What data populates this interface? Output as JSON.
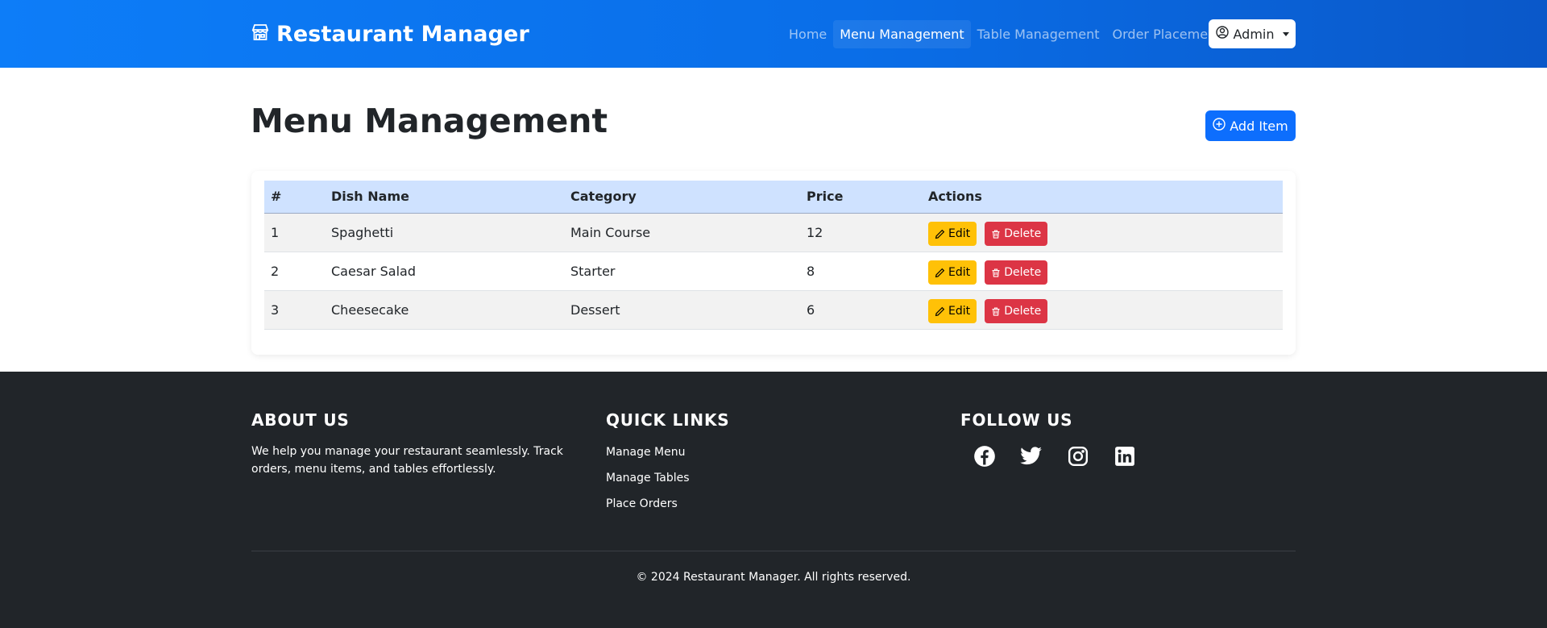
{
  "navbar": {
    "brand": "Restaurant Manager",
    "links": [
      {
        "label": "Home"
      },
      {
        "label": "Menu Management"
      },
      {
        "label": "Table Management"
      },
      {
        "label": "Order Placement"
      }
    ],
    "user_menu": "Admin"
  },
  "page": {
    "title": "Menu Management",
    "add_button": "Add Item"
  },
  "table": {
    "headers": [
      "#",
      "Dish Name",
      "Category",
      "Price",
      "Actions"
    ],
    "rows": [
      {
        "id": "1",
        "name": "Spaghetti",
        "category": "Main Course",
        "price": "12"
      },
      {
        "id": "2",
        "name": "Caesar Salad",
        "category": "Starter",
        "price": "8"
      },
      {
        "id": "3",
        "name": "Cheesecake",
        "category": "Dessert",
        "price": "6"
      }
    ],
    "edit_label": "Edit",
    "delete_label": "Delete"
  },
  "footer": {
    "about": {
      "heading": "ABOUT US",
      "text": "We help you manage your restaurant seamlessly. Track orders, menu items, and tables effortlessly."
    },
    "quick_links": {
      "heading": "QUICK LINKS",
      "links": [
        "Manage Menu",
        "Manage Tables",
        "Place Orders"
      ]
    },
    "follow": {
      "heading": "FOLLOW US",
      "icons": [
        "facebook-icon",
        "twitter-icon",
        "instagram-icon",
        "linkedin-icon"
      ]
    },
    "copyright": "© 2024 Restaurant Manager. All rights reserved."
  },
  "colors": {
    "primary": "#0d6efd",
    "warning": "#ffc107",
    "danger": "#dc3545",
    "footer_bg": "#212529",
    "table_header_bg": "#cfe2ff"
  }
}
